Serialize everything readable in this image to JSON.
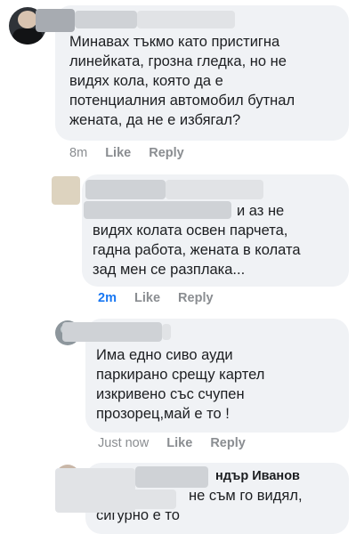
{
  "comments": [
    {
      "text_lines": [
        "Минавах тъкмо като пристигна",
        "линейката, грозна гледка, но не",
        "видях кола, която да е",
        "потенциалния автомобил бутнал",
        "жената, да не е избягал?"
      ],
      "time": "8m",
      "like_label": "Like",
      "reply_label": "Reply"
    },
    {
      "first_line_tail": "и аз не",
      "text_lines": [
        "видях колата освен парчета,",
        "гадна работа, жената в колата",
        "зад мен се разплака..."
      ],
      "time": "2m",
      "like_label": "Like",
      "reply_label": "Reply"
    },
    {
      "text_lines": [
        "Има едно сиво  ауди",
        "паркирано срещу картел",
        "изкривено със счупен",
        "прозорец,май е то !"
      ],
      "time": "Just now",
      "like_label": "Like",
      "reply_label": "Reply"
    },
    {
      "author_partial": "ндър Иванов",
      "first_line_tail": "не съм го видял,",
      "text_lines": [
        "сигурно е то"
      ]
    }
  ],
  "colors": {
    "bubble": "#f0f2f5",
    "meta": "#8a8d91",
    "accent": "#1877f2"
  }
}
